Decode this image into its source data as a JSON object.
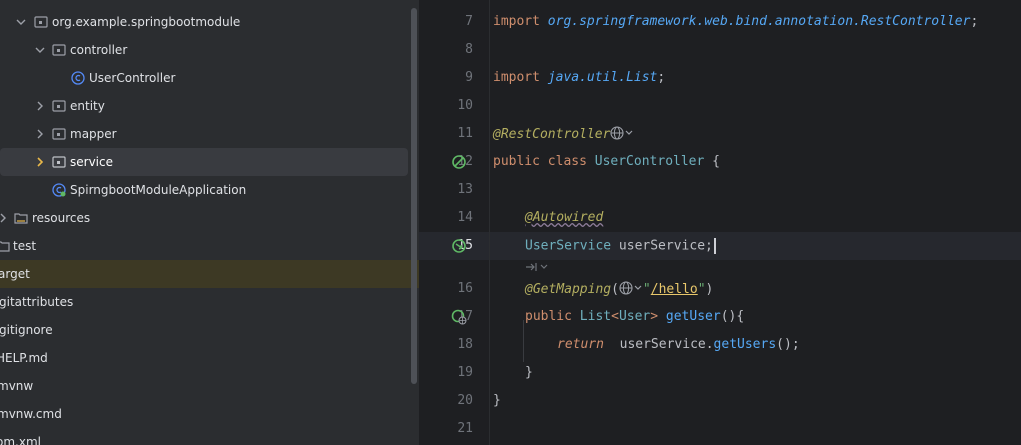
{
  "tree": {
    "items": [
      {
        "label": "org.example.springbootmodule",
        "type": "package",
        "expanded": true
      },
      {
        "label": "controller",
        "type": "package",
        "expanded": true
      },
      {
        "label": "UserController",
        "type": "class"
      },
      {
        "label": "entity",
        "type": "package",
        "expanded": false
      },
      {
        "label": "mapper",
        "type": "package",
        "expanded": false
      },
      {
        "label": "service",
        "type": "package",
        "expanded": false,
        "selected": true
      },
      {
        "label": "SpirngbootModuleApplication",
        "type": "spring-app"
      },
      {
        "label": "resources",
        "type": "folder",
        "expanded": false
      },
      {
        "label": "test",
        "type": "folder"
      },
      {
        "label": "arget",
        "type": "folder",
        "highlighted": true
      },
      {
        "label": "gitattributes",
        "type": "file"
      },
      {
        "label": "gitignore",
        "type": "file"
      },
      {
        "label": "HELP.md",
        "type": "file"
      },
      {
        "label": "mvnw",
        "type": "file"
      },
      {
        "label": "mvnw.cmd",
        "type": "file"
      },
      {
        "label": "om.xml",
        "type": "file"
      }
    ]
  },
  "editor": {
    "line_numbers": [
      "7",
      "8",
      "9",
      "10",
      "11",
      "12",
      "13",
      "14",
      "15",
      "16",
      "17",
      "18",
      "19",
      "20",
      "21"
    ],
    "current_line": "15",
    "code": {
      "l7_kw": "import",
      "l7_path": "org.springframework.web.bind.annotation.RestController",
      "l7_end": ";",
      "l9_kw": "import",
      "l9_path": "java.util.List",
      "l9_end": ";",
      "l11_ann": "@RestController",
      "l12_kw": "public class",
      "l12_cls": "UserController",
      "l12_brace": "{",
      "l14_ann": "@Autowired",
      "l15_cls": "UserService",
      "l15_var": "userService",
      "l15_end": ";",
      "l16_ann": "@GetMapping",
      "l16_open": "(",
      "l16_str_q1": "\"",
      "l16_str": "/hello",
      "l16_str_q2": "\"",
      "l16_close": ")",
      "l17_kw": "public",
      "l17_type": "List",
      "l17_lt": "<",
      "l17_generic": "User",
      "l17_gt": ">",
      "l17_method": "getUser",
      "l17_rest": "(){",
      "l18_kw": "return",
      "l18_obj": "userService",
      "l18_dot": ".",
      "l18_method": "getUsers",
      "l18_rest": "();",
      "l19": "}",
      "l20": "}"
    }
  },
  "colors": {
    "background": "#1e1f22",
    "tree_bg": "#2b2d30",
    "keyword": "#cf8e6d",
    "annotation": "#b3ae60",
    "string": "#6aab73",
    "class": "#6fafbd",
    "method": "#56a8f5"
  }
}
